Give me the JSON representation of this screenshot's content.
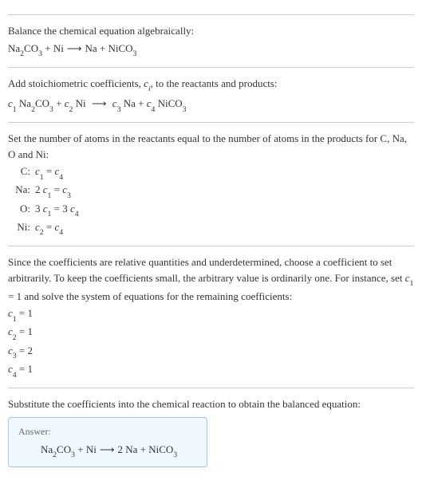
{
  "section1": {
    "title": "Balance the chemical equation algebraically:",
    "equation": "Na₂CO₃ + Ni ⟶ Na + NiCO₃"
  },
  "section2": {
    "title_a": "Add stoichiometric coefficients, ",
    "title_ci": "c",
    "title_i": "i",
    "title_b": ", to the reactants and products:",
    "equation_parts": {
      "c1": "c",
      "n1": "1",
      "sp1": " Na",
      "f1a": "2",
      "f1b": "CO",
      "f1c": "3",
      "plus1": " + ",
      "c2": "c",
      "n2": "2",
      "sp2": " Ni",
      "arrow": " ⟶ ",
      "c3": "c",
      "n3": "3",
      "sp3": " Na + ",
      "c4": "c",
      "n4": "4",
      "sp4": " NiCO",
      "f4": "3"
    }
  },
  "section3": {
    "title": "Set the number of atoms in the reactants equal to the number of atoms in the products for C, Na, O and Ni:",
    "rows": [
      {
        "label": "C:",
        "lhs_c": "c",
        "lhs_n": "1",
        "mid": " = ",
        "rhs_c": "c",
        "rhs_n": "4",
        "pre": ""
      },
      {
        "label": "Na:",
        "pre": "2 ",
        "lhs_c": "c",
        "lhs_n": "1",
        "mid": " = ",
        "rhs_c": "c",
        "rhs_n": "3"
      },
      {
        "label": "O:",
        "pre": "3 ",
        "lhs_c": "c",
        "lhs_n": "1",
        "mid": " = 3 ",
        "rhs_c": "c",
        "rhs_n": "4"
      },
      {
        "label": "Ni:",
        "pre": "",
        "lhs_c": "c",
        "lhs_n": "2",
        "mid": " = ",
        "rhs_c": "c",
        "rhs_n": "4"
      }
    ]
  },
  "section4": {
    "title_a": "Since the coefficients are relative quantities and underdetermined, choose a coefficient to set arbitrarily. To keep the coefficients small, the arbitrary value is ordinarily one. For instance, set ",
    "title_c": "c",
    "title_1": "1",
    "title_b": " = 1 and solve the system of equations for the remaining coefficients:",
    "coeffs": [
      {
        "c": "c",
        "n": "1",
        "val": " = 1"
      },
      {
        "c": "c",
        "n": "2",
        "val": " = 1"
      },
      {
        "c": "c",
        "n": "3",
        "val": " = 2"
      },
      {
        "c": "c",
        "n": "4",
        "val": " = 1"
      }
    ]
  },
  "section5": {
    "title": "Substitute the coefficients into the chemical reaction to obtain the balanced equation:",
    "answer_label": "Answer:",
    "answer_eq": "Na₂CO₃ + Ni ⟶ 2 Na + NiCO₃"
  }
}
